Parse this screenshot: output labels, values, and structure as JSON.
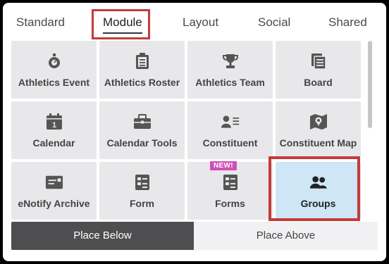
{
  "tabs": [
    {
      "label": "Standard",
      "active": false
    },
    {
      "label": "Module",
      "active": true
    },
    {
      "label": "Layout",
      "active": false
    },
    {
      "label": "Social",
      "active": false
    },
    {
      "label": "Shared",
      "active": false
    }
  ],
  "tiles": [
    {
      "label": "Athletics Event",
      "icon": "stopwatch-icon"
    },
    {
      "label": "Athletics Roster",
      "icon": "clipboard-icon"
    },
    {
      "label": "Athletics Team",
      "icon": "trophy-icon"
    },
    {
      "label": "Board",
      "icon": "documents-icon"
    },
    {
      "label": "Calendar",
      "icon": "calendar-icon"
    },
    {
      "label": "Calendar Tools",
      "icon": "toolbox-icon"
    },
    {
      "label": "Constituent",
      "icon": "person-list-icon"
    },
    {
      "label": "Constituent Map",
      "icon": "map-pin-icon"
    },
    {
      "label": "eNotify Archive",
      "icon": "id-card-icon"
    },
    {
      "label": "Form",
      "icon": "form-icon"
    },
    {
      "label": "Forms",
      "icon": "forms-icon",
      "badge": "NEW!"
    },
    {
      "label": "Groups",
      "icon": "people-icon",
      "selected": true
    }
  ],
  "buttons": {
    "place_below": "Place Below",
    "place_above": "Place Above"
  },
  "colors": {
    "tile_bg": "#e8e7ea",
    "selected_bg": "#cfe6f7",
    "highlight": "#c43b3b",
    "badge": "#d14fb7",
    "dark_button": "#4e4e50"
  }
}
